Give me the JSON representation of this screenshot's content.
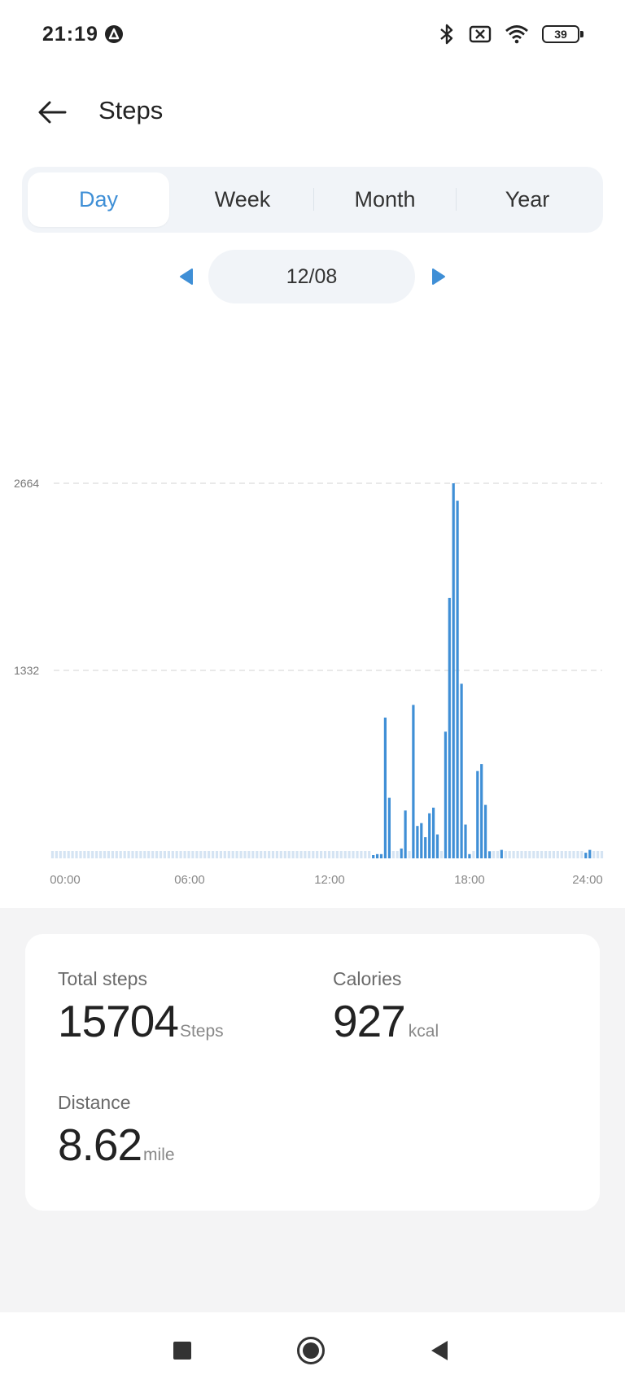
{
  "status_bar": {
    "time": "21:19",
    "battery_level": "39",
    "icons": [
      "a-app-icon",
      "bluetooth-icon",
      "sim-error-icon",
      "wifi-icon",
      "battery-icon"
    ]
  },
  "header": {
    "title": "Steps",
    "back_icon": "arrow-left-icon"
  },
  "tabs": [
    {
      "label": "Day",
      "active": true
    },
    {
      "label": "Week",
      "active": false
    },
    {
      "label": "Month",
      "active": false
    },
    {
      "label": "Year",
      "active": false
    }
  ],
  "date_nav": {
    "date": "12/08",
    "prev_icon": "triangle-left-icon",
    "next_icon": "triangle-right-icon"
  },
  "chart_data": {
    "type": "bar",
    "title": "",
    "xlabel": "",
    "ylabel": "",
    "x_tick_labels": [
      "00:00",
      "06:00",
      "12:00",
      "18:00",
      "24:00"
    ],
    "y_tick_labels": [
      "2664",
      "1332"
    ],
    "ylim": [
      0,
      2664
    ],
    "grid": "dashed horizontal lines at 1332 and 2664",
    "bar_interval_minutes": 10,
    "bar_color": "#3f8fd6",
    "empty_marker_color": "#d5e4f3",
    "series": [
      {
        "start_time": "00:00",
        "values": [
          0,
          0,
          0,
          0,
          0,
          0,
          0,
          0,
          0,
          0,
          0,
          0,
          0,
          0,
          0,
          0,
          0,
          0,
          0,
          0,
          0,
          0,
          0,
          0,
          0,
          0,
          0,
          0,
          0,
          0,
          0,
          0,
          0,
          0,
          0,
          0,
          0,
          0,
          0,
          0,
          0,
          0,
          0,
          0,
          0,
          0,
          0,
          0,
          0,
          0,
          0,
          0,
          0,
          0,
          0,
          0,
          0,
          0,
          0,
          0,
          0,
          0,
          0,
          0,
          0,
          0,
          0,
          0,
          0,
          0,
          0,
          0,
          0,
          0,
          0,
          0,
          0,
          0,
          0,
          0,
          20,
          30,
          30,
          1000,
          430,
          0,
          0,
          70,
          340,
          0,
          1090,
          230,
          250,
          150,
          320,
          360,
          170,
          0,
          900,
          1850,
          2664,
          2540,
          1240,
          240,
          30,
          0,
          620,
          670,
          380,
          50,
          0,
          0,
          60,
          0,
          0,
          0,
          0,
          0,
          0,
          0,
          0,
          0,
          0,
          0,
          0,
          0,
          0,
          0,
          0,
          0,
          0,
          0,
          0,
          40,
          60,
          0,
          0,
          0
        ]
      }
    ]
  },
  "stats": {
    "total_steps": {
      "label": "Total steps",
      "value": "15704",
      "unit": "Steps"
    },
    "calories": {
      "label": "Calories",
      "value": "927",
      "unit": "kcal"
    },
    "distance": {
      "label": "Distance",
      "value": "8.62",
      "unit": "mile"
    }
  },
  "nav_bar": {
    "icons": [
      "recents-square-icon",
      "home-circle-icon",
      "back-triangle-icon"
    ]
  },
  "colors": {
    "accent": "#3f8fd6",
    "tab_background": "#f1f4f8",
    "stats_background": "#f4f4f5"
  }
}
